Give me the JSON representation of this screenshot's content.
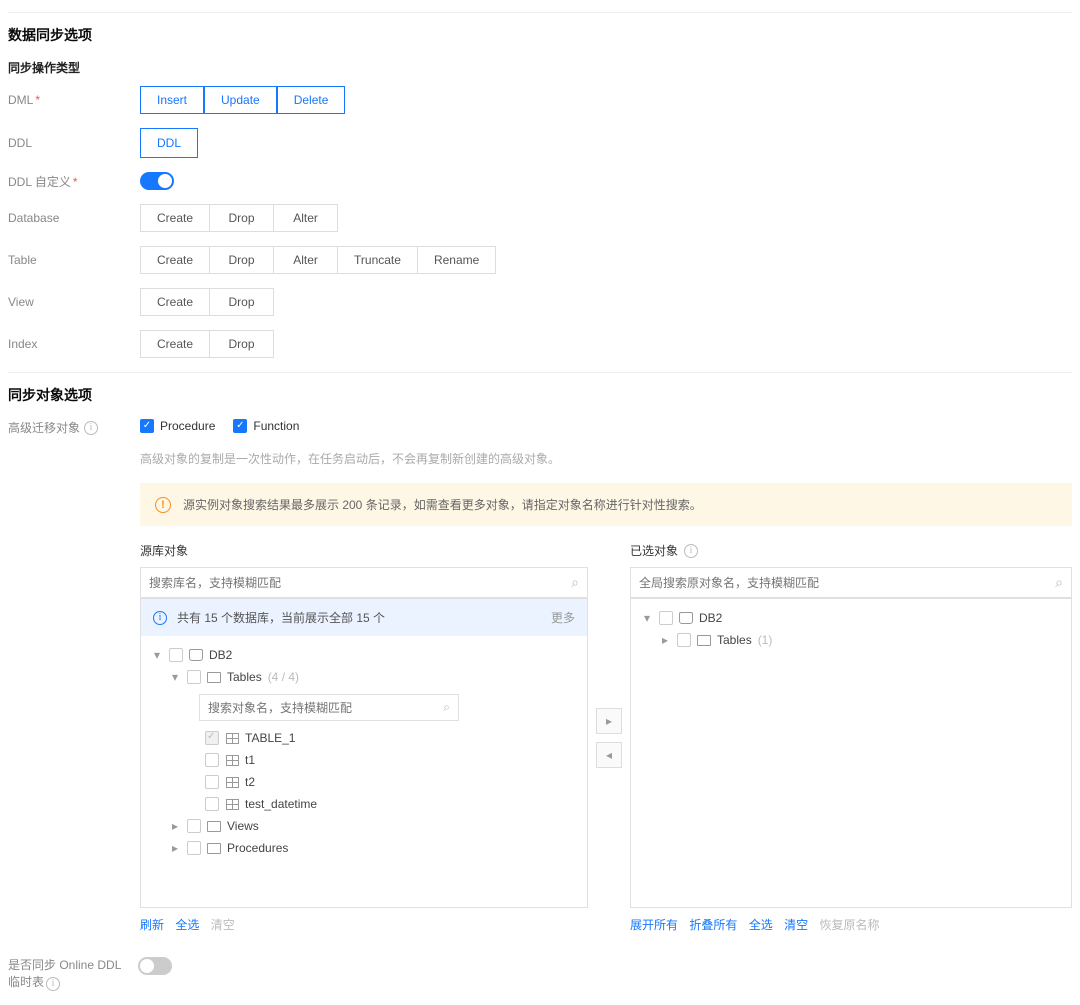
{
  "sync_options": {
    "title": "数据同步选项",
    "sub_title": "同步操作类型",
    "dml_label": "DML",
    "dml": {
      "insert": "Insert",
      "update": "Update",
      "delete": "Delete"
    },
    "ddl_label": "DDL",
    "ddl_btn": "DDL",
    "ddl_custom_label": "DDL 自定义",
    "database_label": "Database",
    "database": {
      "create": "Create",
      "drop": "Drop",
      "alter": "Alter"
    },
    "table_label": "Table",
    "table": {
      "create": "Create",
      "drop": "Drop",
      "alter": "Alter",
      "truncate": "Truncate",
      "rename": "Rename"
    },
    "view_label": "View",
    "view": {
      "create": "Create",
      "drop": "Drop"
    },
    "index_label": "Index",
    "index": {
      "create": "Create",
      "drop": "Drop"
    }
  },
  "targets": {
    "title": "同步对象选项",
    "adv_label": "高级迁移对象",
    "procedure": "Procedure",
    "function": "Function",
    "adv_hint": "高级对象的复制是一次性动作，在任务启动后，不会再复制新创建的高级对象。",
    "alert_text": "源实例对象搜索结果最多展示 200 条记录，如需查看更多对象，请指定对象名称进行针对性搜索。",
    "left": {
      "label": "源库对象",
      "search_ph": "搜索库名，支持模糊匹配",
      "info": "共有 15 个数据库，当前展示全部 15 个",
      "more": "更多",
      "db_name": "DB2",
      "tables_label": "Tables",
      "tables_count": "(4 / 4)",
      "inner_search_ph": "搜索对象名，支持模糊匹配",
      "t1": "TABLE_1",
      "t2": "t1",
      "t3": "t2",
      "t4": "test_datetime",
      "views": "Views",
      "procs": "Procedures",
      "actions": {
        "refresh": "刷新",
        "select_all": "全选",
        "clear": "清空"
      }
    },
    "right": {
      "label": "已选对象",
      "search_ph": "全局搜索原对象名，支持模糊匹配",
      "db_name": "DB2",
      "tables_label": "Tables",
      "tables_count": "(1)",
      "actions": {
        "expand": "展开所有",
        "collapse": "折叠所有",
        "select_all": "全选",
        "clear": "清空",
        "restore": "恢复原名称"
      }
    }
  },
  "online_ddl": {
    "label_l1": "是否同步 Online DDL",
    "label_l2": "临时表"
  }
}
